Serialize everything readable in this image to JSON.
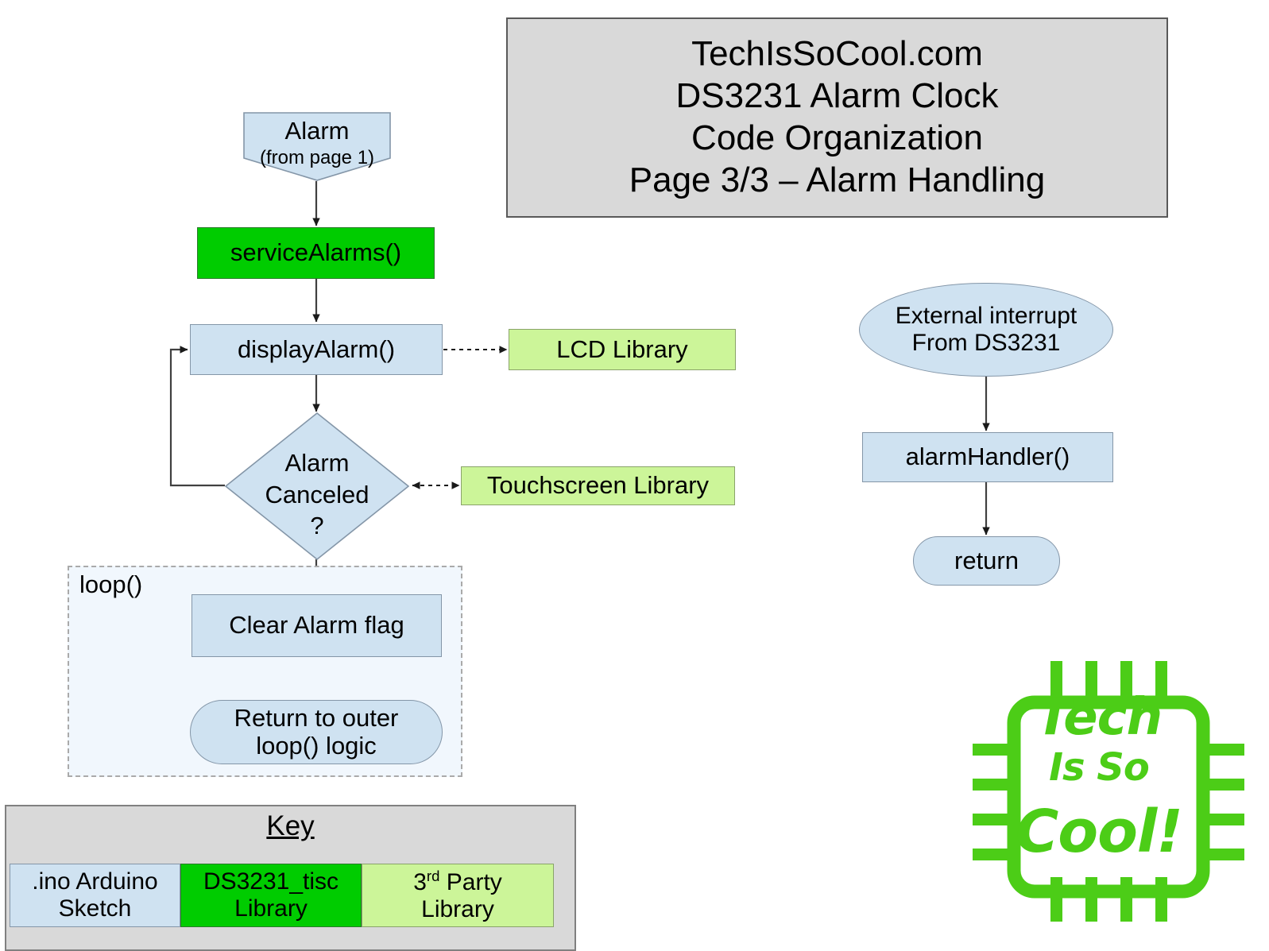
{
  "title": {
    "lines": [
      "TechIsSoCool.com",
      "DS3231 Alarm Clock",
      "Code Organization",
      "Page 3/3 – Alarm Handling"
    ]
  },
  "nodes": {
    "alarm_entry": {
      "label": "Alarm",
      "sublabel": "(from page 1)",
      "shape": "pentagon",
      "category": "ino"
    },
    "service_alarms": {
      "label": "serviceAlarms()",
      "shape": "rect",
      "category": "ds3231_tisc"
    },
    "display_alarm": {
      "label": "displayAlarm()",
      "shape": "rect",
      "category": "ino"
    },
    "lcd_library": {
      "label": "LCD Library",
      "shape": "rect",
      "category": "third_party"
    },
    "alarm_canceled": {
      "label": "Alarm\nCanceled\n?",
      "line1": "Alarm",
      "line2": "Canceled",
      "line3": "?",
      "shape": "diamond",
      "category": "ino"
    },
    "touchscreen_library": {
      "label": "Touchscreen Library",
      "shape": "rect",
      "category": "third_party"
    },
    "clear_alarm_flag": {
      "label": "Clear Alarm flag",
      "shape": "rect",
      "category": "ino"
    },
    "return_outer_loop": {
      "line1": "Return to outer",
      "line2": "loop() logic",
      "shape": "pill",
      "category": "ino"
    },
    "external_interrupt": {
      "line1": "External interrupt",
      "line2": "From DS3231",
      "shape": "ellipse",
      "category": "ino"
    },
    "alarm_handler": {
      "label": "alarmHandler()",
      "shape": "rect",
      "category": "ino"
    },
    "return_node": {
      "label": "return",
      "shape": "pill",
      "category": "ino"
    }
  },
  "containers": {
    "loop": {
      "label": "loop()"
    }
  },
  "key": {
    "title": "Key",
    "items": [
      {
        "line1": ".ino Arduino",
        "line2": "Sketch",
        "category": "ino"
      },
      {
        "line1": "DS3231_tisc",
        "line2": "Library",
        "category": "ds3231_tisc"
      },
      {
        "line1_pre": "3",
        "line1_sup": "rd",
        "line1_post": " Party",
        "line2": "Library",
        "category": "third_party"
      }
    ]
  },
  "logo": {
    "line1": "Tech",
    "line2": "Is So",
    "line3": "Cool!",
    "icon": "microchip-icon"
  },
  "colors": {
    "ino": "#cfe2f1",
    "ds3231_tisc": "#00cc00",
    "third_party": "#ccf599",
    "title_bg": "#d9d9d9",
    "key_bg": "#d9d9d9",
    "loop_bg": "#f1f7fd",
    "logo_green": "#4ccd17",
    "connector": "#404040"
  }
}
